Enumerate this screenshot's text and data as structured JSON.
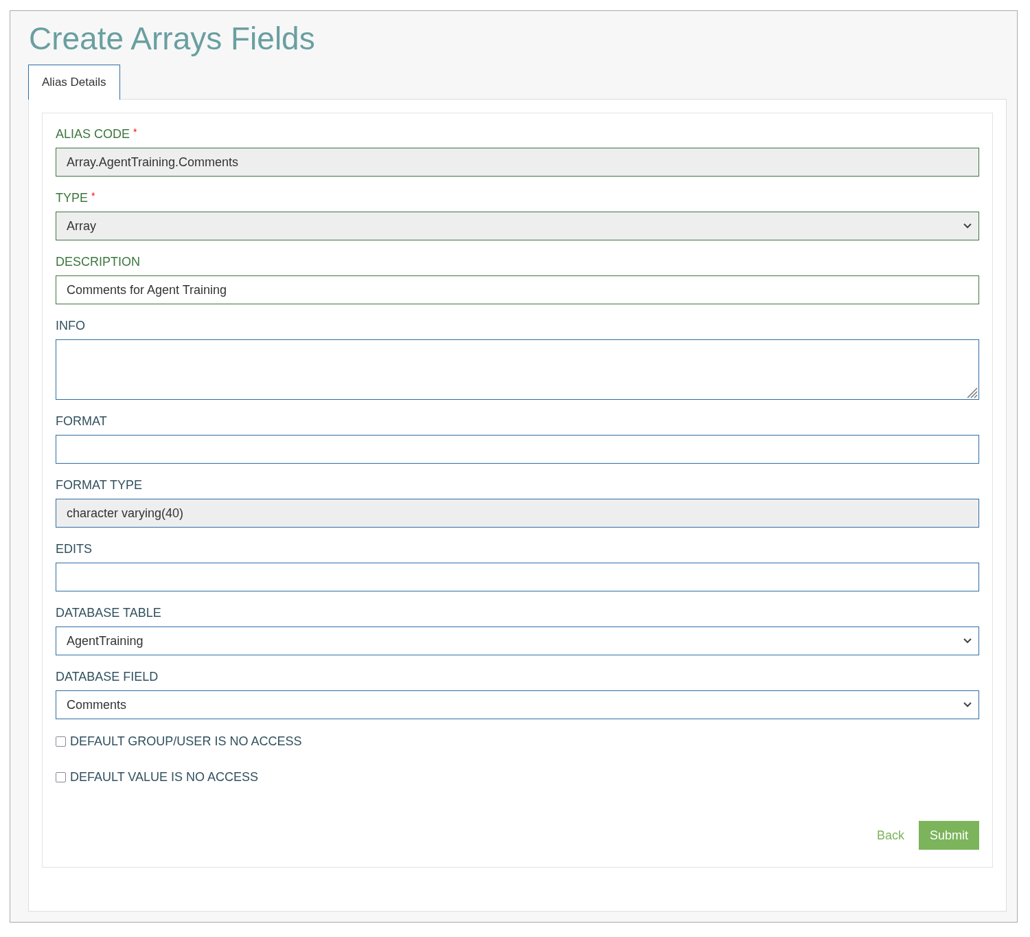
{
  "title": "Create Arrays Fields",
  "tabs": [
    {
      "label": "Alias Details",
      "selected": true
    }
  ],
  "fields": [
    {
      "kind": "text",
      "label": "ALIAS CODE",
      "required_mark": "*",
      "valid": true,
      "readonly": true,
      "value": "Array.AgentTraining.Comments"
    },
    {
      "kind": "select",
      "label": "TYPE",
      "required_mark": "*",
      "valid": true,
      "readonly": true,
      "value": "Array"
    },
    {
      "kind": "text",
      "label": "DESCRIPTION",
      "valid": true,
      "readonly": false,
      "value": "Comments for Agent Training"
    },
    {
      "kind": "textarea",
      "label": "INFO",
      "valid": false,
      "readonly": false
    },
    {
      "kind": "text",
      "label": "FORMAT",
      "valid": false,
      "readonly": false
    },
    {
      "kind": "text",
      "label": "FORMAT TYPE",
      "valid": false,
      "readonly": true,
      "value": "character varying(40)"
    },
    {
      "kind": "text",
      "label": "EDITS",
      "valid": false,
      "readonly": false
    },
    {
      "kind": "select",
      "label": "DATABASE TABLE",
      "valid": false,
      "readonly": false,
      "value": "AgentTraining"
    },
    {
      "kind": "select",
      "label": "DATABASE FIELD",
      "valid": false,
      "readonly": false,
      "value": "Comments"
    }
  ],
  "checkboxes": [
    {
      "label": "DEFAULT GROUP/USER IS NO ACCESS",
      "checked": false
    },
    {
      "label": "DEFAULT VALUE IS NO ACCESS",
      "checked": false
    }
  ],
  "buttons": {
    "back": "Back",
    "submit": "Submit"
  }
}
